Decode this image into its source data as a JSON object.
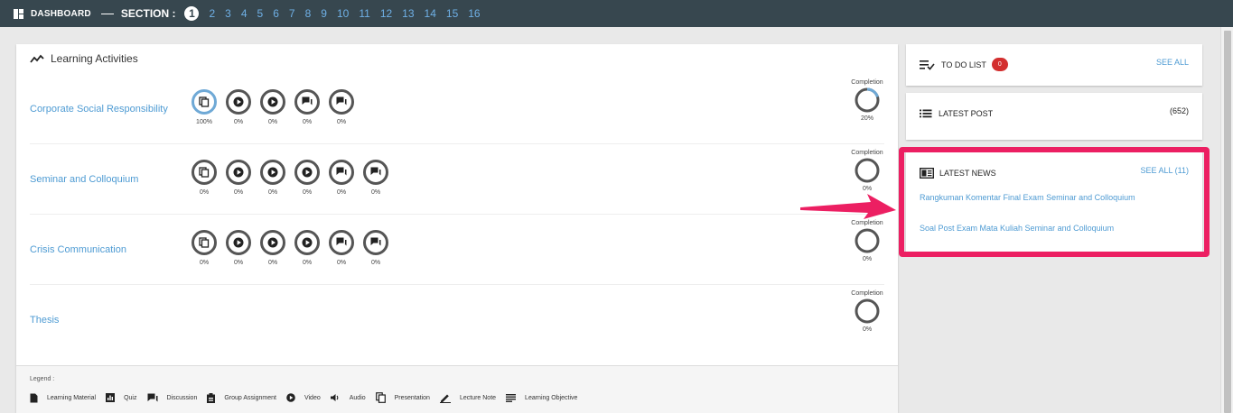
{
  "topbar": {
    "dashboard_label": "DASHBOARD",
    "section_label": "SECTION :",
    "sections": [
      "1",
      "2",
      "3",
      "4",
      "5",
      "6",
      "7",
      "8",
      "9",
      "10",
      "11",
      "12",
      "13",
      "14",
      "15",
      "16"
    ],
    "active_section": "1"
  },
  "main": {
    "title": "Learning Activities",
    "completion_label": "Completion",
    "courses": [
      {
        "name": "Corporate Social Responsibility",
        "activities": [
          {
            "type": "presentation",
            "pct": "100%",
            "full": true
          },
          {
            "type": "video",
            "pct": "0%"
          },
          {
            "type": "video",
            "pct": "0%"
          },
          {
            "type": "discussion",
            "pct": "0%"
          },
          {
            "type": "discussion",
            "pct": "0%"
          }
        ],
        "completion": "20%",
        "completion_value": 0.2
      },
      {
        "name": "Seminar and Colloquium",
        "activities": [
          {
            "type": "presentation",
            "pct": "0%"
          },
          {
            "type": "video",
            "pct": "0%"
          },
          {
            "type": "video",
            "pct": "0%"
          },
          {
            "type": "video",
            "pct": "0%"
          },
          {
            "type": "discussion",
            "pct": "0%"
          },
          {
            "type": "discussion",
            "pct": "0%"
          }
        ],
        "completion": "0%",
        "completion_value": 0
      },
      {
        "name": "Crisis Communication",
        "activities": [
          {
            "type": "presentation",
            "pct": "0%"
          },
          {
            "type": "video",
            "pct": "0%"
          },
          {
            "type": "video",
            "pct": "0%"
          },
          {
            "type": "video",
            "pct": "0%"
          },
          {
            "type": "discussion",
            "pct": "0%"
          },
          {
            "type": "discussion",
            "pct": "0%"
          }
        ],
        "completion": "0%",
        "completion_value": 0
      },
      {
        "name": "Thesis",
        "activities": [],
        "completion": "0%",
        "completion_value": 0
      }
    ]
  },
  "legend": {
    "title": "Legend :",
    "items": [
      {
        "icon": "learning-material-icon",
        "label": "Learning Material"
      },
      {
        "icon": "quiz-icon",
        "label": "Quiz"
      },
      {
        "icon": "discussion-icon",
        "label": "Discussion"
      },
      {
        "icon": "group-assignment-icon",
        "label": "Group Assignment"
      },
      {
        "icon": "video-icon",
        "label": "Video"
      },
      {
        "icon": "audio-icon",
        "label": "Audio"
      },
      {
        "icon": "presentation-icon",
        "label": "Presentation"
      },
      {
        "icon": "lecture-note-icon",
        "label": "Lecture Note"
      },
      {
        "icon": "learning-objective-icon",
        "label": "Learning Objective"
      }
    ]
  },
  "todo": {
    "title": "TO DO LIST",
    "count": "0",
    "see_all": "SEE ALL"
  },
  "latest_post": {
    "title": "LATEST POST",
    "count": "(652)"
  },
  "latest_news": {
    "title": "LATEST NEWS",
    "see_all": "SEE ALL (11)",
    "items": [
      "Rangkuman Komentar Final Exam Seminar and Colloquium",
      "Soal Post Exam Mata Kuliah Seminar and Colloquium"
    ]
  },
  "colors": {
    "topbar": "#37474f",
    "link": "#4e9bd3",
    "highlight": "#ec1f62",
    "badge": "#d32f2f",
    "progress": "#6fa9d6"
  }
}
